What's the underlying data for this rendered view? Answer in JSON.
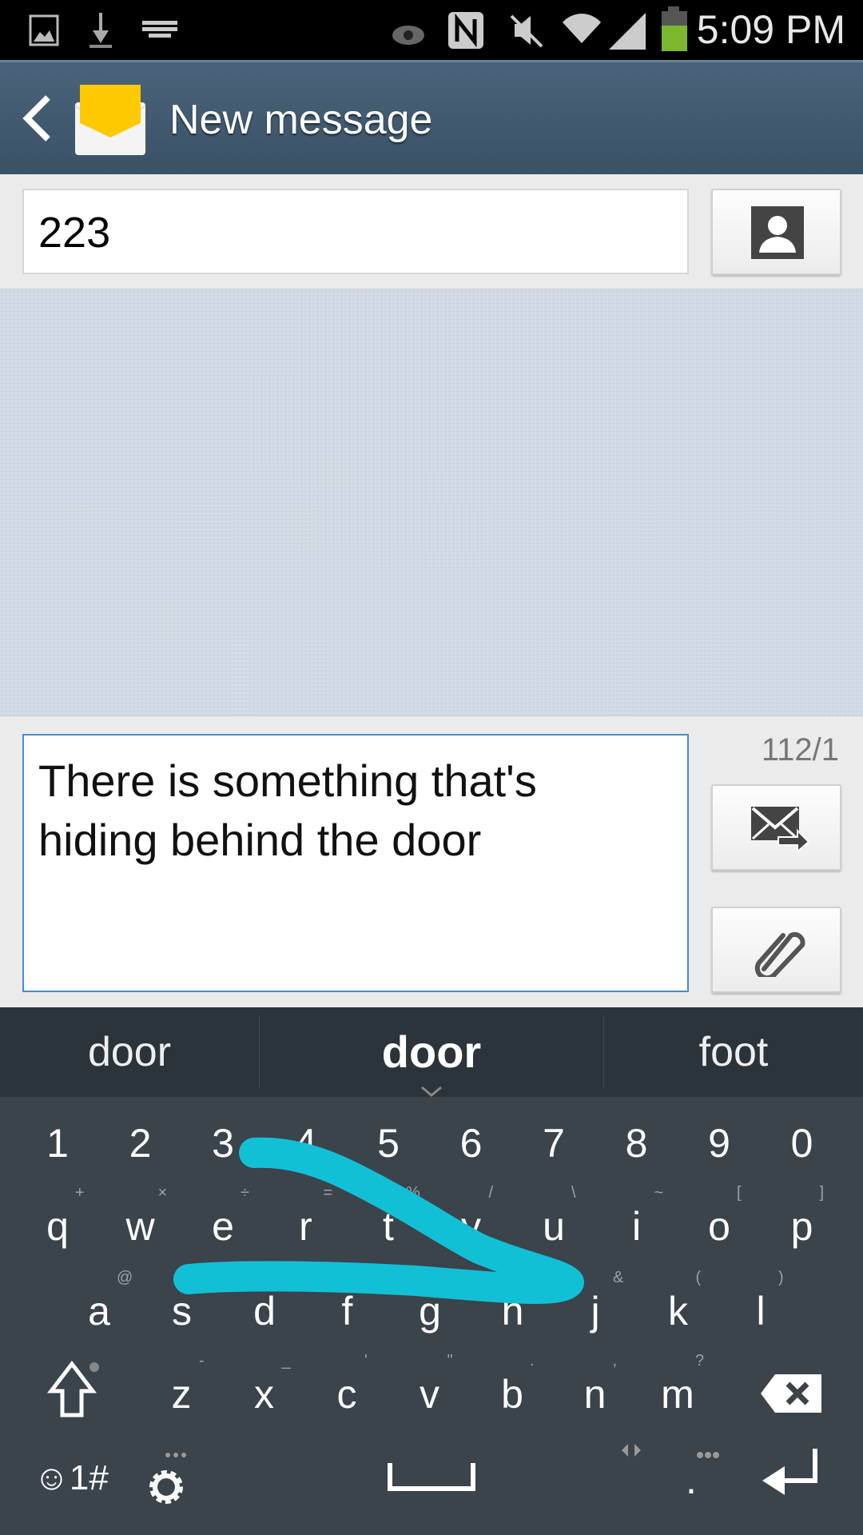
{
  "status_bar": {
    "time": "5:09 PM",
    "icons": [
      "gallery-icon",
      "download-icon",
      "keyboard-icon",
      "smart-stay-eye-icon",
      "nfc-icon",
      "mute-icon",
      "wifi-icon",
      "signal-icon",
      "battery-icon"
    ],
    "battery_color": "#7cb82f"
  },
  "header": {
    "title": "New message",
    "back_icon": "chevron-left-icon",
    "app_icon": "envelope-icon"
  },
  "recipient": {
    "value": "223",
    "contact_icon": "contact-picker-icon"
  },
  "compose": {
    "text_line1": "There is something that's",
    "text_line2": "hiding behind the door",
    "counter": "112/1",
    "send_icon": "send-mms-icon",
    "attach_icon": "paperclip-icon"
  },
  "suggestions": [
    "door",
    "door",
    "foot"
  ],
  "keyboard": {
    "numbers": [
      "1",
      "2",
      "3",
      "4",
      "5",
      "6",
      "7",
      "8",
      "9",
      "0"
    ],
    "row1": [
      [
        "q",
        "+"
      ],
      [
        "w",
        "×"
      ],
      [
        "e",
        "÷"
      ],
      [
        "r",
        "="
      ],
      [
        "t",
        "%"
      ],
      [
        "y",
        "/"
      ],
      [
        "u",
        "\\"
      ],
      [
        "i",
        "~"
      ],
      [
        "o",
        "["
      ],
      [
        "p",
        "]"
      ]
    ],
    "row2": [
      [
        "a",
        "@"
      ],
      [
        "s",
        "*"
      ],
      [
        "d",
        "!"
      ],
      [
        "f",
        "#"
      ],
      [
        "g",
        ":"
      ],
      [
        "h",
        ";"
      ],
      [
        "j",
        "&"
      ],
      [
        "k",
        "("
      ],
      [
        "l",
        ")"
      ]
    ],
    "row3": [
      [
        "z",
        "-"
      ],
      [
        "x",
        "_"
      ],
      [
        "c",
        "'"
      ],
      [
        "v",
        "\""
      ],
      [
        "b",
        "."
      ],
      [
        "n",
        ","
      ],
      [
        "m",
        "?"
      ]
    ],
    "symbols_label": "☺1#",
    "period": ".",
    "swipe_color": "#12c0d6"
  }
}
